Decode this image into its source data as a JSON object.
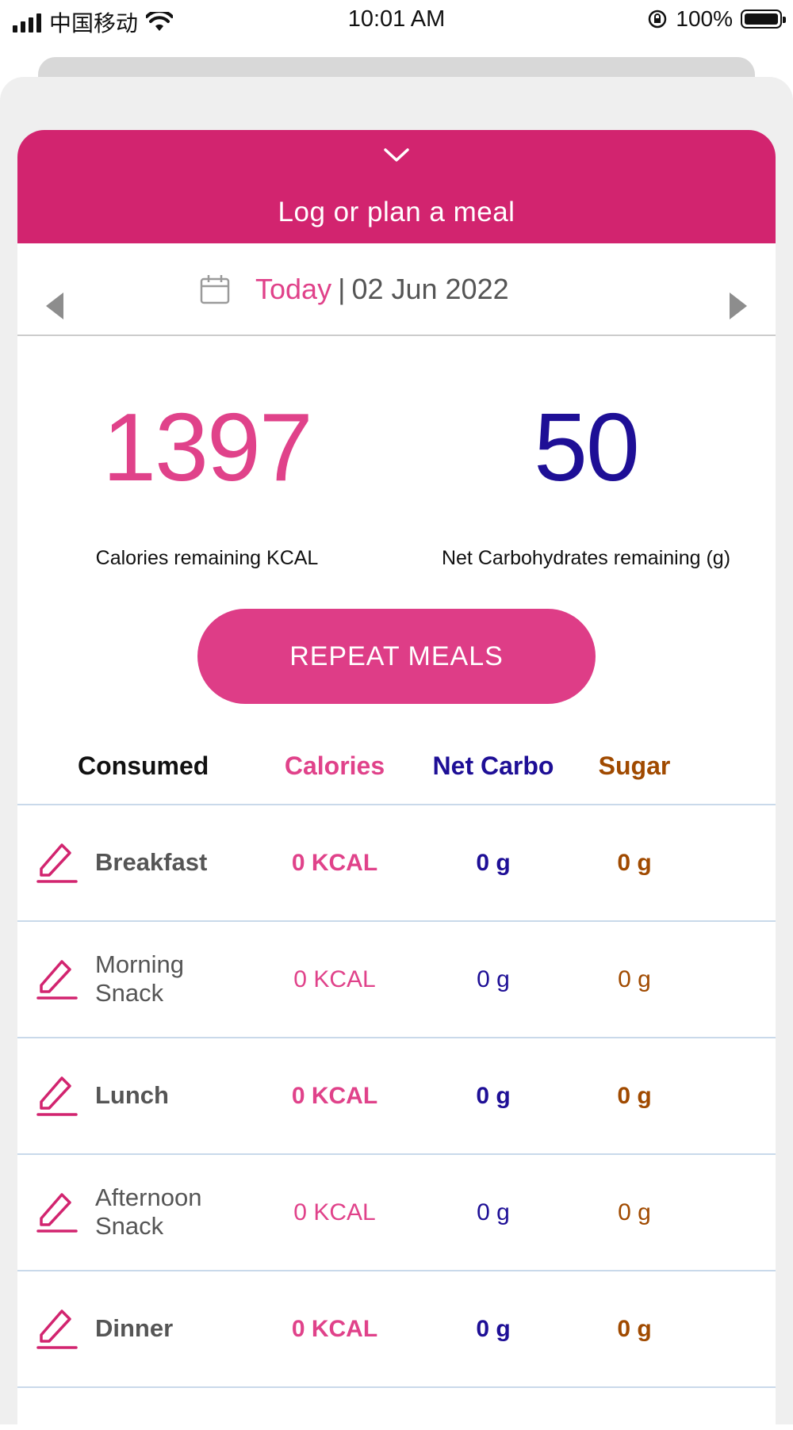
{
  "status_bar": {
    "carrier": "中国移动",
    "time": "10:01 AM",
    "battery": "100%"
  },
  "header": {
    "title": "Log or plan a meal"
  },
  "date_nav": {
    "today_label": "Today",
    "separator": "|",
    "date": "02 Jun 2022"
  },
  "summary": {
    "calories_remaining": "1397",
    "calories_label": "Calories remaining KCAL",
    "carbs_remaining": "50",
    "carbs_label": "Net Carbohydrates remaining (g)"
  },
  "repeat_button": "REPEAT MEALS",
  "table": {
    "headers": [
      "Consumed",
      "Calories",
      "Net Carbo",
      "Sugar"
    ],
    "rows": [
      {
        "name": "Breakfast",
        "calories": "0 KCAL",
        "carbs": "0 g",
        "sugar": "0 g"
      },
      {
        "name": "Morning Snack",
        "calories": "0 KCAL",
        "carbs": "0 g",
        "sugar": "0 g"
      },
      {
        "name": "Lunch",
        "calories": "0 KCAL",
        "carbs": "0 g",
        "sugar": "0 g"
      },
      {
        "name": "Afternoon Snack",
        "calories": "0 KCAL",
        "carbs": "0 g",
        "sugar": "0 g"
      },
      {
        "name": "Dinner",
        "calories": "0 KCAL",
        "carbs": "0 g",
        "sugar": "0 g"
      }
    ]
  },
  "colors": {
    "brand_pink": "#d2246f",
    "calories_pink": "#e0428a",
    "carbs_navy": "#1e0f96",
    "sugar_brown": "#a04a00"
  },
  "icons": {
    "row_edit": "pencil-icon",
    "date": "calendar-icon",
    "collapse": "chevron-down-icon"
  }
}
